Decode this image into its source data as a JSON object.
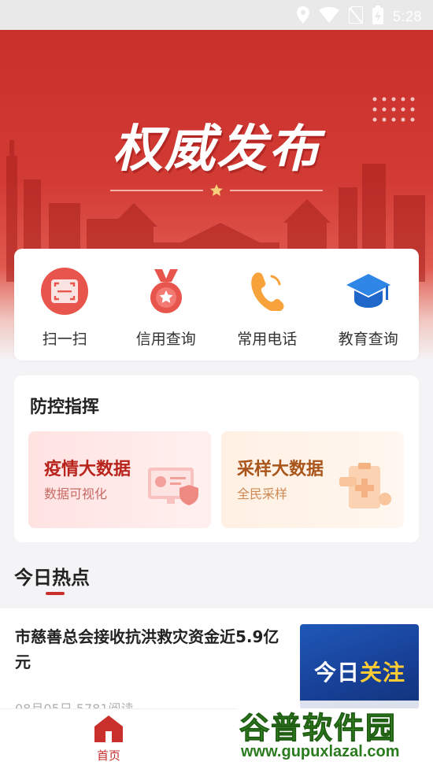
{
  "status_bar": {
    "time": "5:28"
  },
  "hero": {
    "title": "权威发布"
  },
  "quick_actions": [
    {
      "label": "扫一扫",
      "icon": "scan-icon"
    },
    {
      "label": "信用查询",
      "icon": "credit-medal-icon"
    },
    {
      "label": "常用电话",
      "icon": "phone-icon"
    },
    {
      "label": "教育查询",
      "icon": "graduation-cap-icon"
    }
  ],
  "prevention": {
    "title": "防控指挥",
    "tiles": [
      {
        "title": "疫情大数据",
        "subtitle": "数据可视化",
        "icon": "dashboard-shield-icon"
      },
      {
        "title": "采样大数据",
        "subtitle": "全民采样",
        "icon": "clipboard-plus-icon"
      }
    ]
  },
  "hot": {
    "title": "今日热点",
    "news": [
      {
        "headline": "市慈善总会接收抗洪救灾资金近5.9亿元",
        "meta": "08月05日  5781阅读",
        "thumb_text_a": "今日",
        "thumb_text_b": "关注"
      }
    ]
  },
  "tabbar": {
    "home_label": "首页"
  },
  "watermark": {
    "logo": "谷普软件园",
    "url": "www.gupuxlazal.com"
  },
  "colors": {
    "brand_red": "#c9302c",
    "banner_red": "#d23a34"
  }
}
